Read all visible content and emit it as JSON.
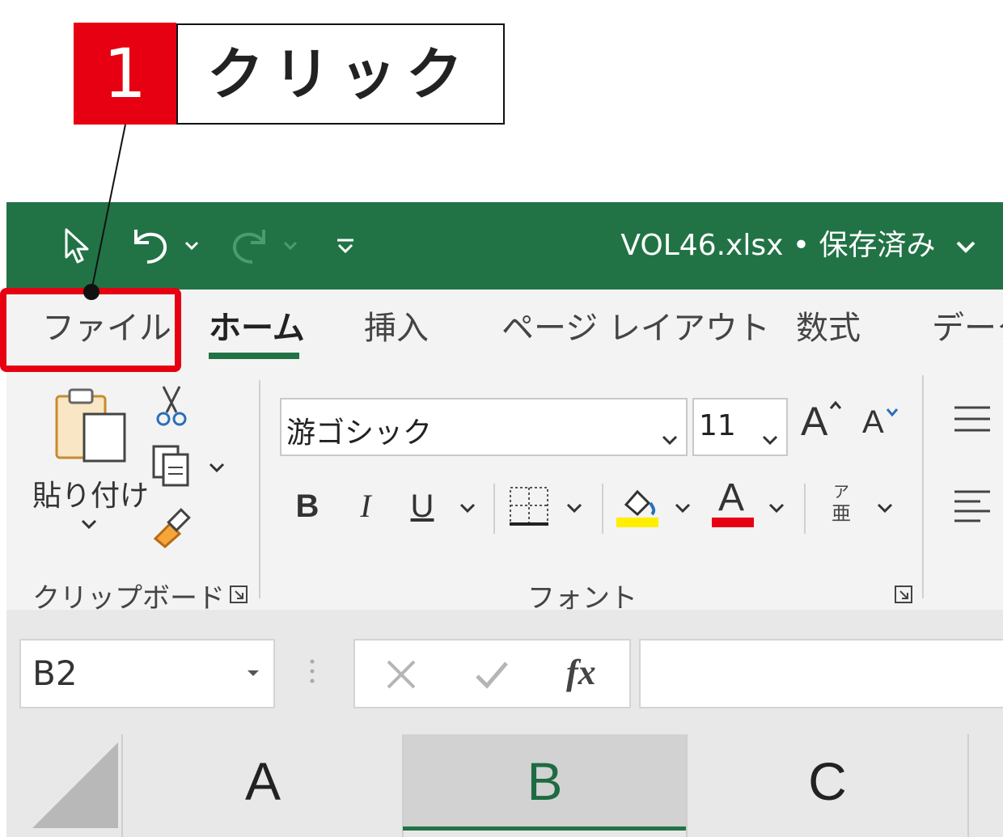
{
  "callout": {
    "step_number": "1",
    "label": "クリック"
  },
  "title_bar": {
    "document_title": "VOL46.xlsx • 保存済み",
    "icons": [
      "pointer-icon",
      "undo-icon",
      "redo-icon",
      "customize-quick-access-icon",
      "title-dropdown-icon"
    ],
    "accent_color": "#217346"
  },
  "tabs": [
    {
      "label": "ファイル"
    },
    {
      "label": "ホーム",
      "active": true
    },
    {
      "label": "挿入"
    },
    {
      "label": "ページ レイアウト"
    },
    {
      "label": "数式"
    },
    {
      "label": "データ"
    }
  ],
  "clipboard": {
    "paste_label": "貼り付け",
    "group_label": "クリップボード",
    "icons": [
      "paste-icon",
      "cut-icon",
      "copy-icon",
      "format-painter-icon"
    ]
  },
  "font": {
    "font_name": "游ゴシック",
    "font_size": "11",
    "bold": "B",
    "italic": "I",
    "underline": "U",
    "font_color_glyph": "A",
    "grow_glyph": "A",
    "shrink_glyph": "A",
    "phonetic_top": "ア",
    "phonetic_bottom": "亜",
    "group_label": "フォント",
    "fill_color": "#ffee00",
    "font_color": "#e60012"
  },
  "formula_bar": {
    "name_box": "B2",
    "fx_label": "fx",
    "formula": ""
  },
  "columns": [
    "A",
    "B",
    "C"
  ],
  "selected_column": "B",
  "highlight_color": "#e60012"
}
